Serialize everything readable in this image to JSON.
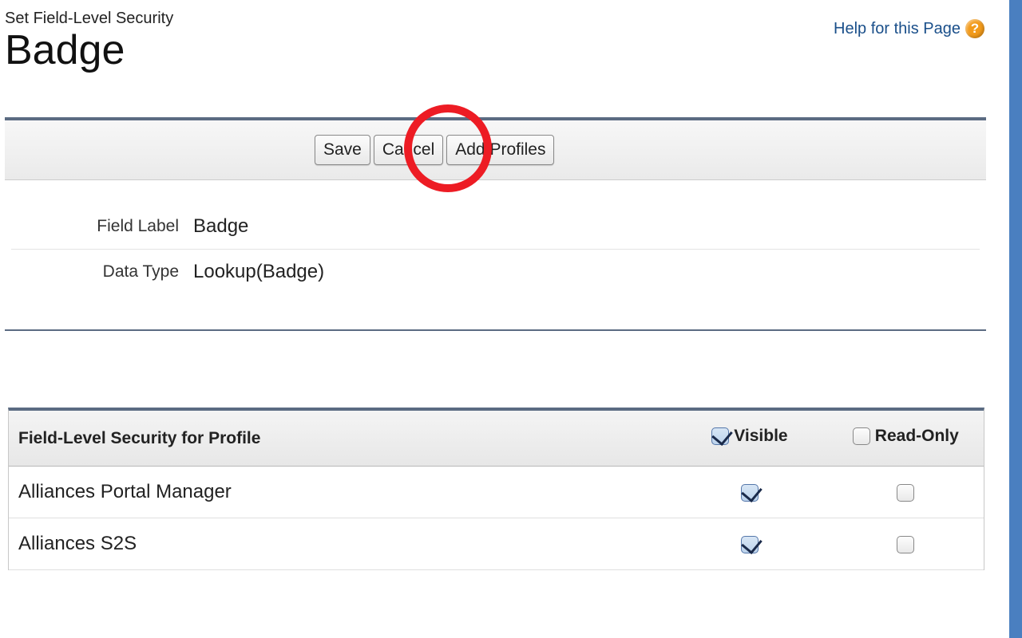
{
  "header": {
    "subtitle": "Set Field-Level Security",
    "title": "Badge",
    "help_label": "Help for this Page",
    "help_icon_char": "?"
  },
  "buttons": {
    "save": "Save",
    "cancel": "Cancel",
    "add_profiles": "Add Profiles"
  },
  "details": {
    "field_label_name": "Field Label",
    "field_label_value": "Badge",
    "data_type_name": "Data Type",
    "data_type_value": "Lookup(Badge)"
  },
  "table": {
    "header_profile": "Field-Level Security for Profile",
    "header_visible": "Visible",
    "header_readonly": "Read-Only",
    "header_visible_checked": true,
    "header_readonly_checked": false,
    "rows": [
      {
        "profile": "Alliances Portal Manager",
        "visible": true,
        "readonly": false
      },
      {
        "profile": "Alliances S2S",
        "visible": true,
        "readonly": false
      }
    ]
  }
}
